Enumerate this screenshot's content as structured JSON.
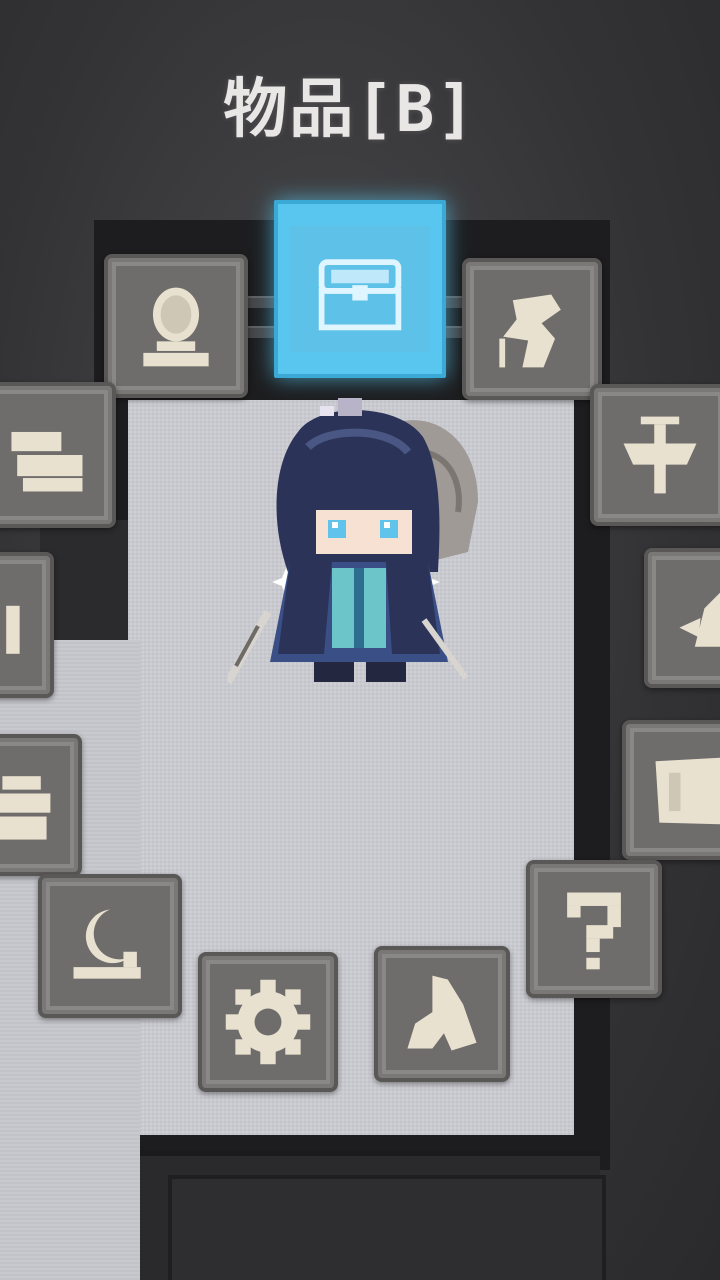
{
  "menu": {
    "title": "物品[B]"
  },
  "wheel": {
    "items": [
      {
        "name": "chest",
        "icon": "treasure-chest-icon",
        "selected": true
      },
      {
        "name": "mirror",
        "icon": "round-mirror-icon",
        "selected": false
      },
      {
        "name": "statue",
        "icon": "statue-icon",
        "selected": false
      },
      {
        "name": "books",
        "icon": "books-icon",
        "selected": false
      },
      {
        "name": "banner",
        "icon": "banner-icon",
        "selected": false
      },
      {
        "name": "figure",
        "icon": "figure-icon",
        "selected": false
      },
      {
        "name": "creature",
        "icon": "creature-icon",
        "selected": false
      },
      {
        "name": "cake",
        "icon": "cake-icon",
        "selected": false
      },
      {
        "name": "scroll",
        "icon": "scroll-icon",
        "selected": false
      },
      {
        "name": "moon",
        "icon": "moon-icon",
        "selected": false
      },
      {
        "name": "question",
        "icon": "question-icon",
        "selected": false
      },
      {
        "name": "settings",
        "icon": "gear-icon",
        "selected": false
      },
      {
        "name": "hand",
        "icon": "hand-icon",
        "selected": false
      }
    ]
  },
  "colors": {
    "selected_tile": "#59c6ef",
    "tile": "#8a8887",
    "icon": "#e9e1cf",
    "floor": "#cfd0d6"
  }
}
